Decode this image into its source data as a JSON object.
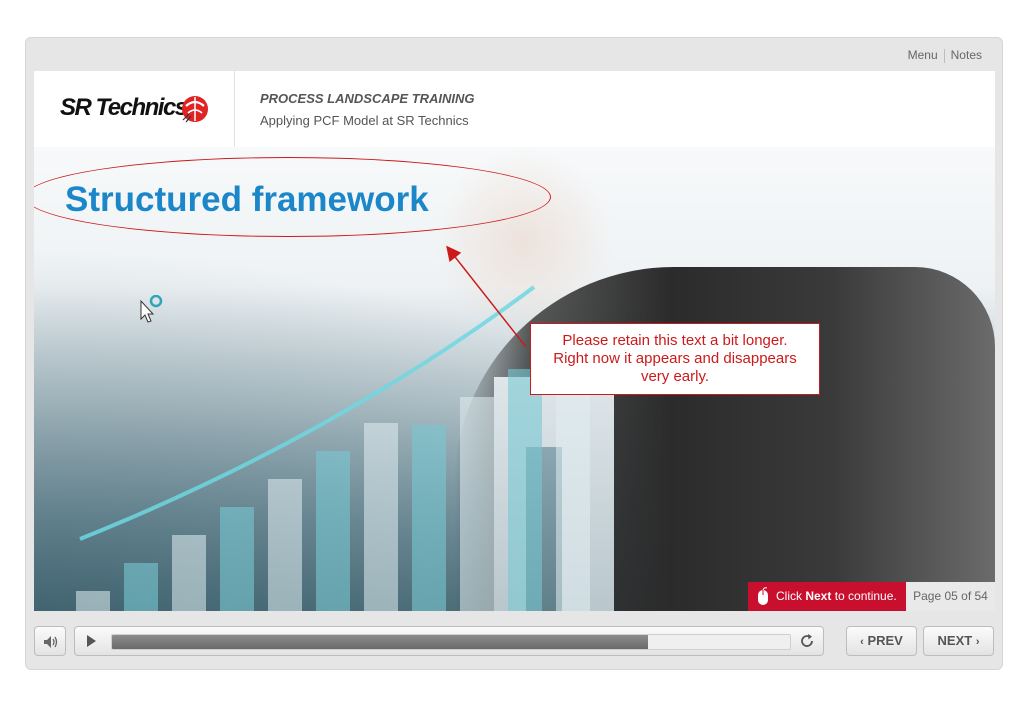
{
  "toplinks": {
    "menu": "Menu",
    "notes": "Notes"
  },
  "header": {
    "logo_text": "SR Technics",
    "course_title": "PROCESS LANDSCAPE TRAINING",
    "course_subtitle": "Applying PCF Model at SR Technics"
  },
  "slide": {
    "title": "Structured framework",
    "callout_lines": [
      "Please retain this text a bit longer.",
      "Right now it appears and disappears",
      "very early."
    ],
    "chart_bar_count": 11
  },
  "footer": {
    "continue_prefix": "Click ",
    "continue_bold": "Next",
    "continue_suffix": " to continue.",
    "page_label": "Page 05 of 54"
  },
  "controls": {
    "prev_label": "PREV",
    "next_label": "NEXT",
    "progress": 0.79
  },
  "colors": {
    "title_blue": "#1b87c9",
    "annotation_red": "#cc1a1a",
    "continue_red": "#c8102e",
    "logo_red": "#e02424"
  },
  "icons": {
    "volume": "speaker-icon",
    "play": "play-icon",
    "replay": "replay-icon",
    "prev": "chevron-left-icon",
    "next": "chevron-right-icon",
    "mouse": "mouse-icon",
    "cursor": "busy-cursor-icon"
  }
}
